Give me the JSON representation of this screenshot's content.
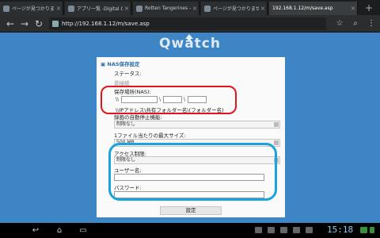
{
  "tabs": [
    {
      "label": "ページが見つかりませ..."
    },
    {
      "label": "アプリ一覧 -Digital Gene"
    },
    {
      "label": "Rotten Tangerines - And"
    },
    {
      "label": "ページが見つかりませ..."
    },
    {
      "label": "192.168.1.12/m/save.asp"
    }
  ],
  "address": {
    "url": "http://192.168.1.12/m/save.asp"
  },
  "page": {
    "logo": "Qwatch",
    "section_title": "NAS保存設定",
    "status_label": "ステータス:",
    "status_value": "非接続",
    "location_label": "保存場所(NAS):",
    "path_sep1": "\\\\",
    "path_sep2": "\\",
    "path_sep3": "\\",
    "path_hint": "\\\\IPアドレス\\共有フォルダー名\\(フォルダー名)",
    "auto_stop_label": "録画の自動停止機能:",
    "auto_stop_value": "制限なし",
    "max_size_label": "1ファイル当たりの最大サイズ:",
    "max_size_value": "500 MB",
    "access_label": "アクセス制限:",
    "access_value": "制限なし",
    "user_label": "ユーザー名:",
    "password_label": "パスワード:",
    "submit_label": "設定"
  },
  "system": {
    "clock": "15:18"
  },
  "colors": {
    "page_bg": "#3d85c4",
    "red_highlight": "#e0141e",
    "blue_highlight": "#1aa3dd"
  }
}
